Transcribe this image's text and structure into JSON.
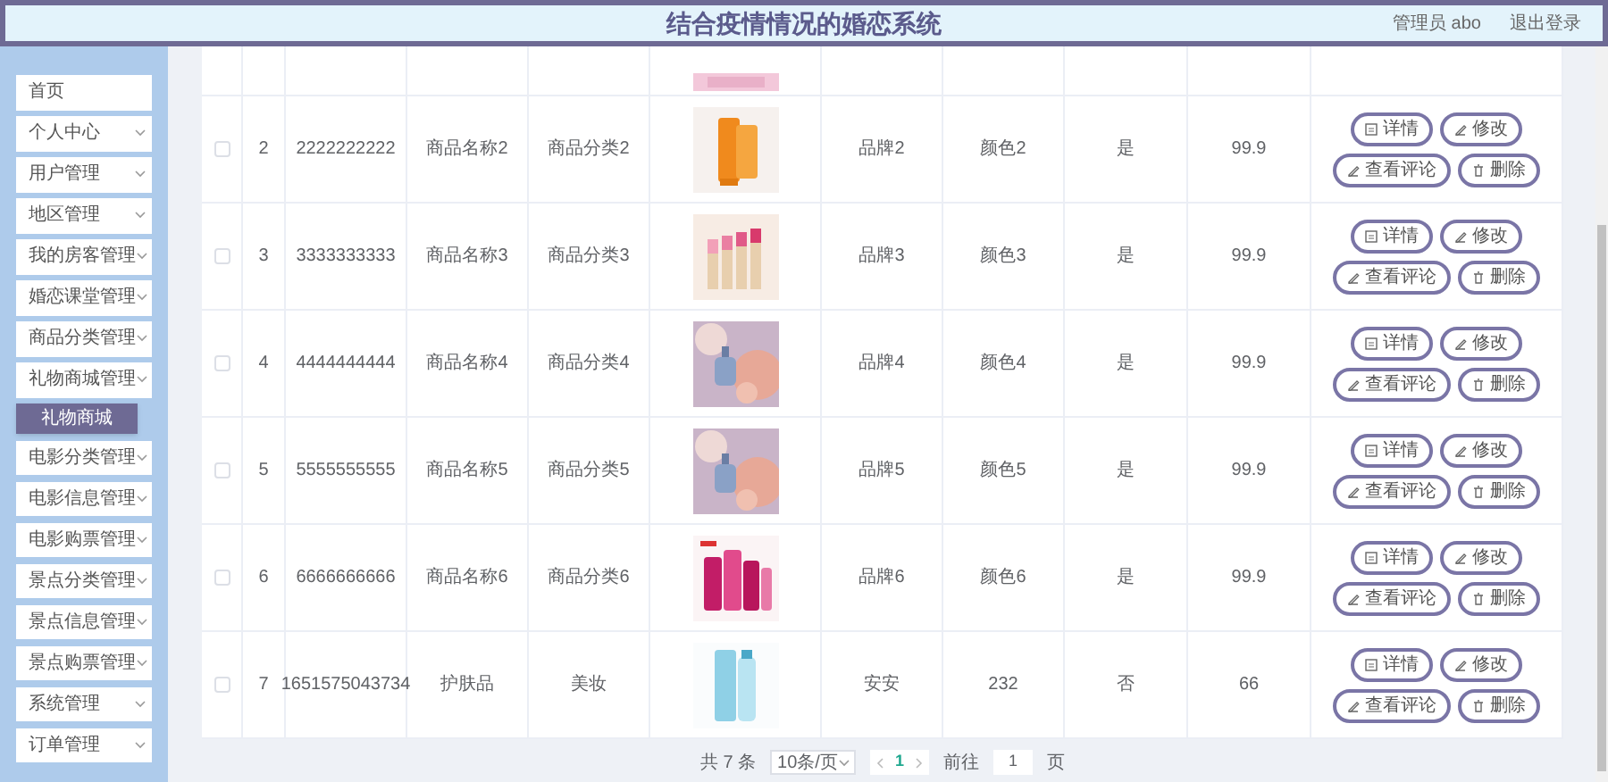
{
  "header": {
    "title": "结合疫情情况的婚恋系统",
    "user": "管理员 abo",
    "logout": "退出登录"
  },
  "sidebar": {
    "items": [
      {
        "label": "首页",
        "kind": "link"
      },
      {
        "label": "个人中心",
        "kind": "menu"
      },
      {
        "label": "用户管理",
        "kind": "menu"
      },
      {
        "label": "地区管理",
        "kind": "menu"
      },
      {
        "label": "我的房客管理",
        "kind": "menu"
      },
      {
        "label": "婚恋课堂管理",
        "kind": "menu"
      },
      {
        "label": "商品分类管理",
        "kind": "menu"
      },
      {
        "label": "礼物商城管理",
        "kind": "menu",
        "children": [
          {
            "label": "礼物商城",
            "selected": true
          }
        ]
      },
      {
        "label": "电影分类管理",
        "kind": "menu"
      },
      {
        "label": "电影信息管理",
        "kind": "menu"
      },
      {
        "label": "电影购票管理",
        "kind": "menu"
      },
      {
        "label": "景点分类管理",
        "kind": "menu"
      },
      {
        "label": "景点信息管理",
        "kind": "menu"
      },
      {
        "label": "景点购票管理",
        "kind": "menu"
      },
      {
        "label": "系统管理",
        "kind": "menu"
      },
      {
        "label": "订单管理",
        "kind": "menu"
      }
    ]
  },
  "table": {
    "rows": [
      {
        "checked": false,
        "index": "2",
        "code": "2222222222",
        "name": "商品名称2",
        "category": "商品分类2",
        "brand": "品牌2",
        "shade": "颜色2",
        "flag": "是",
        "price": "99.9",
        "actions": [
          "详情",
          "修改",
          "查看评论",
          "删除"
        ]
      },
      {
        "checked": false,
        "index": "3",
        "code": "3333333333",
        "name": "商品名称3",
        "category": "商品分类3",
        "brand": "品牌3",
        "shade": "颜色3",
        "flag": "是",
        "price": "99.9",
        "actions": [
          "详情",
          "修改",
          "查看评论",
          "删除"
        ]
      },
      {
        "checked": false,
        "index": "4",
        "code": "4444444444",
        "name": "商品名称4",
        "category": "商品分类4",
        "brand": "品牌4",
        "shade": "颜色4",
        "flag": "是",
        "price": "99.9",
        "actions": [
          "详情",
          "修改",
          "查看评论",
          "删除"
        ]
      },
      {
        "checked": false,
        "index": "5",
        "code": "5555555555",
        "name": "商品名称5",
        "category": "商品分类5",
        "brand": "品牌5",
        "shade": "颜色5",
        "flag": "是",
        "price": "99.9",
        "actions": [
          "详情",
          "修改",
          "查看评论",
          "删除"
        ]
      },
      {
        "checked": false,
        "index": "6",
        "code": "6666666666",
        "name": "商品名称6",
        "category": "商品分类6",
        "brand": "品牌6",
        "shade": "颜色6",
        "flag": "是",
        "price": "99.9",
        "actions": [
          "详情",
          "修改",
          "查看评论",
          "删除"
        ]
      },
      {
        "checked": false,
        "index": "7",
        "code": "1651575043734",
        "name": "护肤品",
        "category": "美妆",
        "brand": "安安",
        "shade": "232",
        "flag": "否",
        "price": "66",
        "actions": [
          "详情",
          "修改",
          "查看评论",
          "删除"
        ]
      }
    ]
  },
  "pagination": {
    "total": "共 7 条",
    "page_size": "10条/页",
    "pages": [
      {
        "label": "1",
        "selected": true
      }
    ],
    "goto_label": "前往",
    "goto_value": "1",
    "page_suffix": "页"
  }
}
